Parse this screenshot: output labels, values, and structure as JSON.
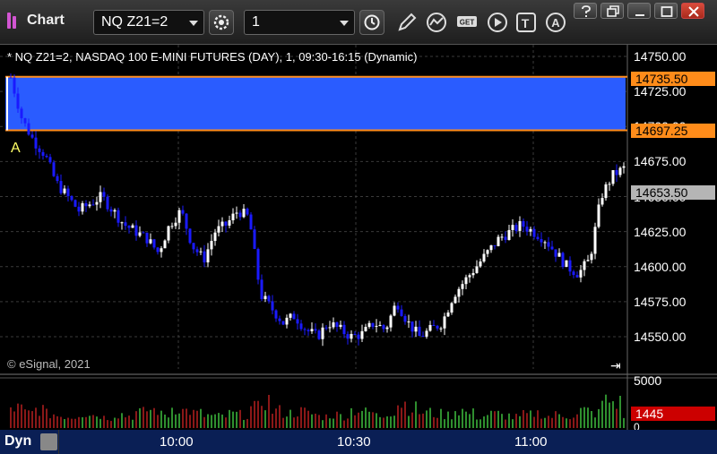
{
  "toolbar": {
    "app_title": "Chart",
    "symbol": "NQ Z21=2",
    "interval": "1"
  },
  "chart": {
    "header": "* NQ Z21=2, NASDAQ 100 E-MINI FUTURES (DAY), 1, 09:30-16:15 (Dynamic)",
    "copyright": "© eSignal, 2021",
    "marker": "A",
    "price_ticks": [
      "14750.00",
      "14725.00",
      "14700.00",
      "14675.00",
      "14650.00",
      "14625.00",
      "14600.00",
      "14575.00",
      "14550.00"
    ],
    "price_flags": {
      "upper": "14735.50",
      "lower": "14697.25",
      "last": "14653.50"
    },
    "zone": {
      "upper": 14735.5,
      "lower": 14697.25,
      "color": "#2a5cff",
      "edge_color": "#ff8c1a"
    },
    "volume_ticks": [
      "5000",
      "0"
    ],
    "volume_last": "1445",
    "time_ticks": [
      "10:00",
      "10:30",
      "11:00"
    ],
    "dyn_label": "Dyn",
    "colors": {
      "up": "#ffffff",
      "down": "#1a1aff",
      "vol_up": "#3fbf3f",
      "vol_down": "#b82020",
      "grid": "#3a3a3a"
    },
    "visible_price_range": [
      14536,
      14760
    ],
    "volume_range": [
      0,
      5000
    ]
  },
  "chart_data": {
    "type": "candlestick",
    "x_labels": [
      "10:00",
      "10:30",
      "11:00"
    ],
    "close_path": [
      14735,
      14705,
      14690,
      14680,
      14660,
      14650,
      14640,
      14645,
      14650,
      14640,
      14630,
      14625,
      14620,
      14610,
      14630,
      14640,
      14615,
      14605,
      14625,
      14630,
      14640,
      14635,
      14580,
      14570,
      14560,
      14565,
      14555,
      14550,
      14560,
      14555,
      14550,
      14552,
      14560,
      14555,
      14575,
      14560,
      14550,
      14555,
      14560,
      14580,
      14590,
      14600,
      14610,
      14620,
      14625,
      14630,
      14625,
      14620,
      14610,
      14600,
      14595,
      14605,
      14650,
      14665,
      14670
    ],
    "volume_hint": [
      2400,
      1800,
      2300,
      1700,
      1500,
      1400,
      1800,
      1600,
      1300,
      1700,
      1500,
      1900,
      2200,
      1600,
      2500,
      2100,
      1800,
      1500,
      1400,
      1700,
      1600,
      2400,
      3300,
      2100,
      1800,
      2000,
      1700,
      1400,
      1600,
      1500,
      2200,
      1900,
      1500,
      2000,
      3000,
      2400,
      1900,
      1700,
      1600,
      2200,
      1800,
      1400,
      1700,
      1500,
      1300,
      1600,
      1800,
      1400,
      1600,
      1500,
      2100,
      1800,
      3300,
      3100,
      1445
    ]
  }
}
